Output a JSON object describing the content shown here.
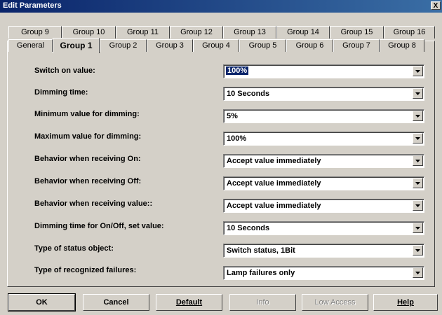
{
  "window": {
    "title": "Edit Parameters",
    "close_glyph": "X"
  },
  "tabs_back": [
    "Group 9",
    "Group 10",
    "Group 11",
    "Group 12",
    "Group 13",
    "Group 14",
    "Group 15",
    "Group 16"
  ],
  "tabs_front": [
    "General",
    "Group 1",
    "Group 2",
    "Group 3",
    "Group 4",
    "Group 5",
    "Group 6",
    "Group 7",
    "Group 8"
  ],
  "active_tab": "Group 1",
  "params": [
    {
      "label": "Switch on value:",
      "value": "100%"
    },
    {
      "label": "Dimming time:",
      "value": "10 Seconds"
    },
    {
      "label": "Minimum value for dimming:",
      "value": "5%"
    },
    {
      "label": "Maximum value for dimming:",
      "value": "100%"
    },
    {
      "label": "Behavior when receiving On:",
      "value": "Accept value immediately"
    },
    {
      "label": "Behavior when receiving Off:",
      "value": "Accept value immediately"
    },
    {
      "label": "Behavior when receiving value::",
      "value": "Accept value immediately"
    },
    {
      "label": "Dimming time for On/Off, set value:",
      "value": "10 Seconds"
    },
    {
      "label": "Type of status object:",
      "value": "Switch status, 1Bit"
    },
    {
      "label": "Type of recognized failures:",
      "value": "Lamp failures only"
    }
  ],
  "buttons": {
    "ok": "OK",
    "cancel": "Cancel",
    "default": "Default",
    "info": "Info",
    "low_access": "Low Access",
    "help": "Help"
  }
}
